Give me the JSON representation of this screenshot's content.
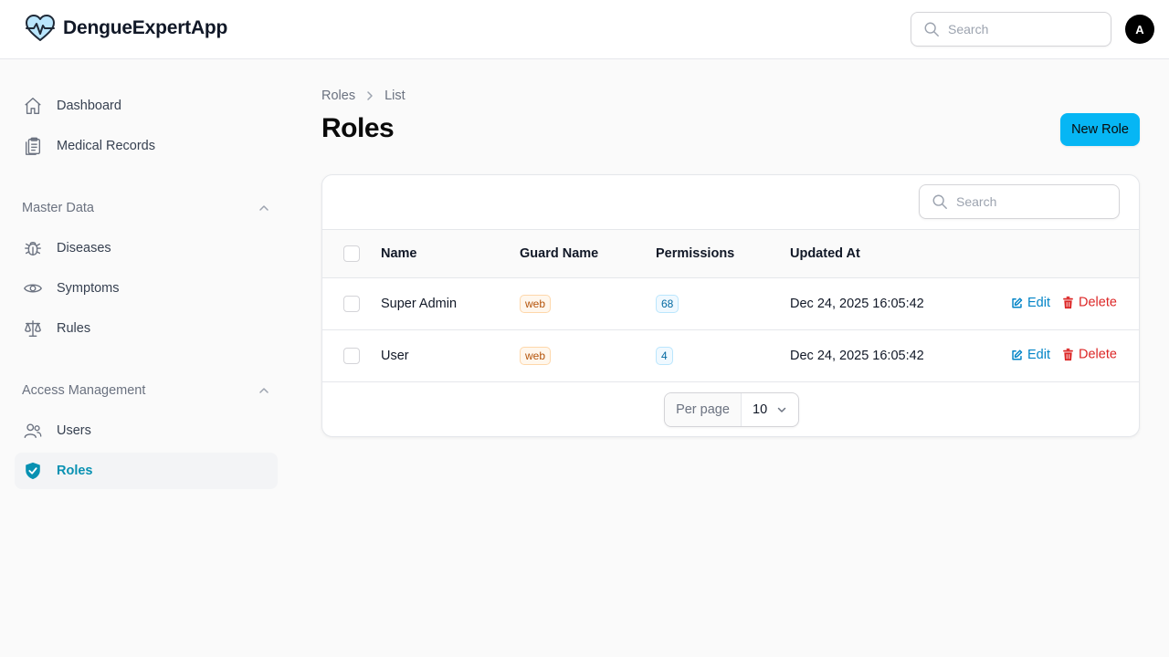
{
  "app": {
    "name": "DengueExpertApp",
    "brand_color": "#06b6f4",
    "user_initial": "A"
  },
  "topbar": {
    "search_placeholder": "Search"
  },
  "sidebar": {
    "items": [
      {
        "label": "Dashboard",
        "icon": "home-icon"
      },
      {
        "label": "Medical Records",
        "icon": "clipboard-icon"
      }
    ],
    "groups": [
      {
        "label": "Master Data",
        "items": [
          {
            "label": "Diseases",
            "icon": "bug-icon"
          },
          {
            "label": "Symptoms",
            "icon": "eye-icon"
          },
          {
            "label": "Rules",
            "icon": "scale-icon"
          }
        ]
      },
      {
        "label": "Access Management",
        "items": [
          {
            "label": "Users",
            "icon": "users-icon"
          },
          {
            "label": "Roles",
            "icon": "shield-check-icon",
            "active": true
          }
        ]
      }
    ]
  },
  "breadcrumb": [
    "Roles",
    "List"
  ],
  "page": {
    "title": "Roles",
    "new_button": "New Role"
  },
  "table": {
    "search_placeholder": "Search",
    "columns": [
      "Name",
      "Guard Name",
      "Permissions",
      "Updated At"
    ],
    "rows": [
      {
        "name": "Super Admin",
        "guard": "web",
        "permissions": "68",
        "updated_at": "Dec 24, 2025 16:05:42"
      },
      {
        "name": "User",
        "guard": "web",
        "permissions": "4",
        "updated_at": "Dec 24, 2025 16:05:42"
      }
    ],
    "actions": {
      "edit": "Edit",
      "delete": "Delete"
    },
    "per_page_label": "Per page",
    "per_page_value": "10"
  }
}
